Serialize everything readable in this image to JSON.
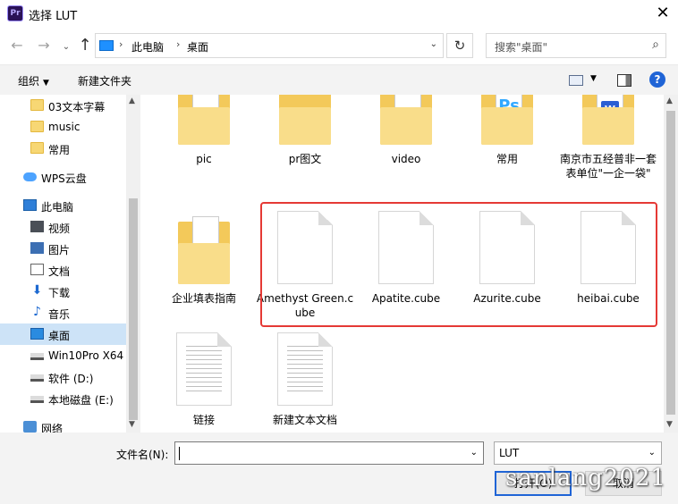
{
  "window": {
    "title": "选择 LUT",
    "app_icon": "Pr"
  },
  "nav": {
    "path": [
      "此电脑",
      "桌面"
    ],
    "search_placeholder": "搜索\"桌面\""
  },
  "commandbar": {
    "organize": "组织",
    "new_folder": "新建文件夹",
    "help": "?"
  },
  "sidebar": {
    "items": [
      {
        "label": "03文本字幕",
        "icon": "folder-icon"
      },
      {
        "label": "music",
        "icon": "folder-icon"
      },
      {
        "label": "常用",
        "icon": "folder-icon"
      },
      {
        "label": "WPS云盘",
        "icon": "cloud-icon"
      },
      {
        "label": "此电脑",
        "icon": "computer-icon"
      },
      {
        "label": "视频",
        "icon": "video-icon"
      },
      {
        "label": "图片",
        "icon": "picture-icon"
      },
      {
        "label": "文档",
        "icon": "document-icon"
      },
      {
        "label": "下载",
        "icon": "download-icon"
      },
      {
        "label": "音乐",
        "icon": "music-icon"
      },
      {
        "label": "桌面",
        "icon": "desktop-icon",
        "selected": true
      },
      {
        "label": "Win10Pro X64",
        "icon": "drive-icon"
      },
      {
        "label": "软件 (D:)",
        "icon": "drive-icon"
      },
      {
        "label": "本地磁盘 (E:)",
        "icon": "drive-icon"
      },
      {
        "label": "网络",
        "icon": "network-icon"
      }
    ]
  },
  "files": [
    {
      "label": "pic",
      "type": "folder"
    },
    {
      "label": "pr图文",
      "type": "folder"
    },
    {
      "label": "video",
      "type": "folder"
    },
    {
      "label": "常用",
      "type": "folder"
    },
    {
      "label": "南京市五经普非一套表单位\"一企一袋\"",
      "type": "folder"
    },
    {
      "label": "企业填表指南",
      "type": "folder"
    },
    {
      "label": "Amethyst Green.cube",
      "type": "file"
    },
    {
      "label": "Apatite.cube",
      "type": "file"
    },
    {
      "label": "Azurite.cube",
      "type": "file"
    },
    {
      "label": "heibai.cube",
      "type": "file"
    },
    {
      "label": "链接",
      "type": "text-file"
    },
    {
      "label": "新建文本文档",
      "type": "text-file"
    }
  ],
  "footer": {
    "filename_label": "文件名(N):",
    "filename_value": "",
    "filetype_value": "LUT",
    "open_label": "打开(O)",
    "cancel_label": "取消"
  },
  "watermark": "sanlang2021",
  "colors": {
    "highlight": "#e53935",
    "selection": "#cde3f7",
    "accent": "#1f64d6"
  }
}
